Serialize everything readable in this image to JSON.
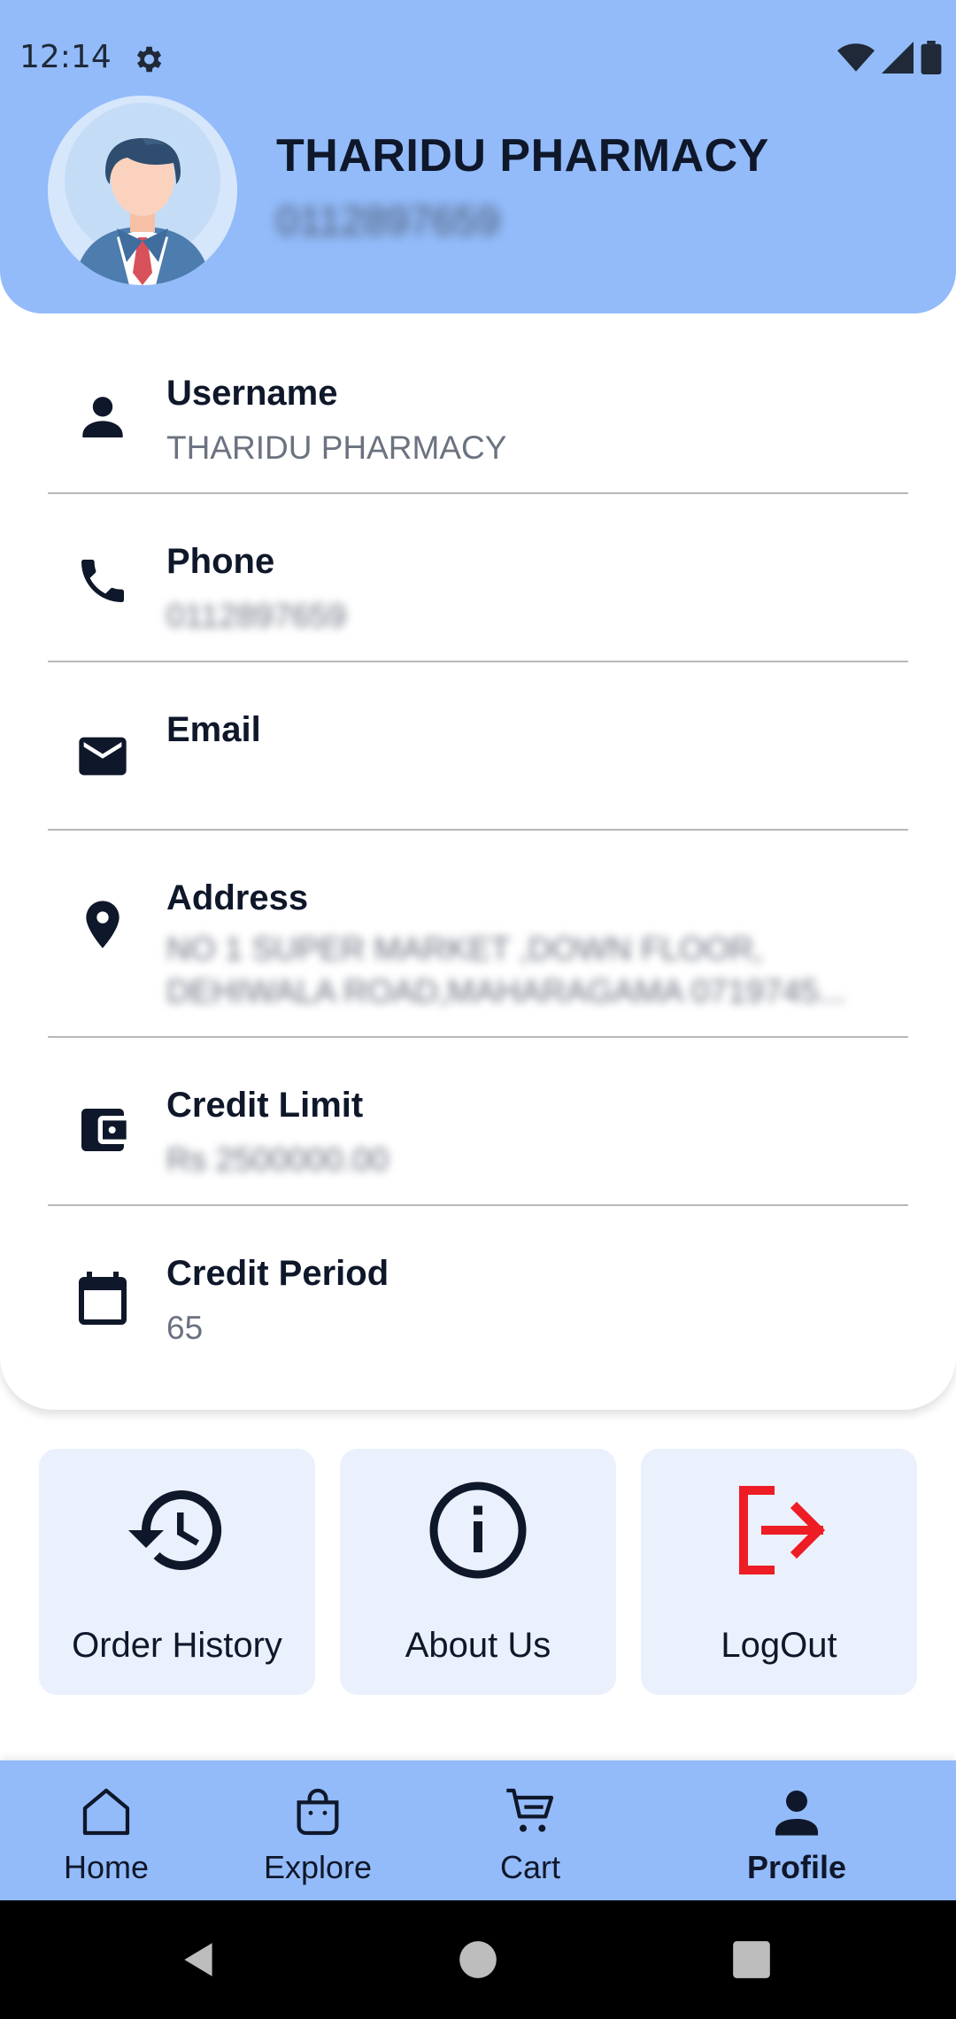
{
  "status_bar": {
    "time": "12:14"
  },
  "profile": {
    "name": "THARIDU PHARMACY",
    "phone": "0112897659"
  },
  "details": [
    {
      "label": "Username",
      "value": "THARIDU PHARMACY",
      "icon": "person-icon"
    },
    {
      "label": "Phone",
      "value": "0112897659",
      "icon": "phone-icon"
    },
    {
      "label": "Email",
      "value": "",
      "icon": "mail-icon"
    },
    {
      "label": "Address",
      "value": "NO 1 SUPER MARKET ,DOWN FLOOR, DEHIWALA ROAD,MAHARAGAMA 0719745...",
      "icon": "location-icon"
    },
    {
      "label": "Credit Limit",
      "value": "Rs 2500000.00",
      "icon": "wallet-icon"
    },
    {
      "label": "Credit Period",
      "value": "65",
      "icon": "calendar-icon"
    }
  ],
  "actions": [
    {
      "label": "Order History",
      "icon": "history-icon"
    },
    {
      "label": "About Us",
      "icon": "info-icon"
    },
    {
      "label": "LogOut",
      "icon": "logout-icon"
    }
  ],
  "bottom_nav": {
    "items": [
      {
        "label": "Home",
        "icon": "home-icon"
      },
      {
        "label": "Explore",
        "icon": "bag-icon"
      },
      {
        "label": "Cart",
        "icon": "cart-icon"
      },
      {
        "label": "Profile",
        "icon": "profile-icon",
        "active": true
      }
    ]
  },
  "colors": {
    "header_bg": "#93bbfa",
    "tile_bg": "#eaf0fc",
    "logout_red": "#ee1c24",
    "text_dark": "#0f172a",
    "text_muted": "#6b7280"
  }
}
